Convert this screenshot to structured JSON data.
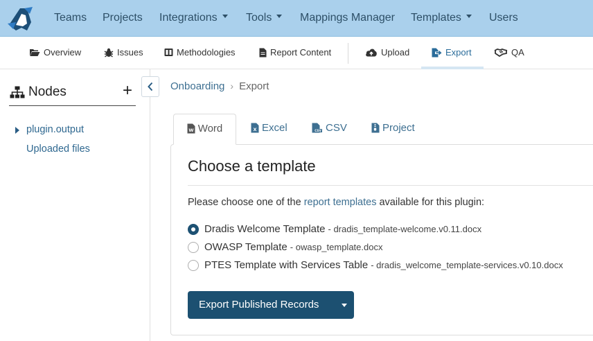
{
  "topnav": {
    "items": [
      {
        "label": "Teams"
      },
      {
        "label": "Projects"
      },
      {
        "label": "Integrations"
      },
      {
        "label": "Tools"
      },
      {
        "label": "Mappings Manager"
      },
      {
        "label": "Templates"
      },
      {
        "label": "Users"
      }
    ]
  },
  "subnav": {
    "items": [
      {
        "label": "Overview",
        "icon": "folder-open-icon"
      },
      {
        "label": "Issues",
        "icon": "bug-icon"
      },
      {
        "label": "Methodologies",
        "icon": "book-icon"
      },
      {
        "label": "Report Content",
        "icon": "file-icon"
      },
      {
        "label": "Upload",
        "icon": "cloud-upload-icon"
      },
      {
        "label": "Export",
        "icon": "export-icon"
      },
      {
        "label": "QA",
        "icon": "handshake-icon"
      }
    ],
    "active": "Export"
  },
  "sidebar": {
    "title": "Nodes",
    "add_label": "+",
    "nodes": [
      {
        "label": "plugin.output"
      },
      {
        "label": "Uploaded files"
      }
    ]
  },
  "breadcrumb": {
    "parent": "Onboarding",
    "current": "Export"
  },
  "tabs": [
    {
      "label": "Word",
      "icon": "file-word-icon"
    },
    {
      "label": "Excel",
      "icon": "file-excel-icon"
    },
    {
      "label": "CSV",
      "icon": "file-csv-icon"
    },
    {
      "label": "Project",
      "icon": "file-archive-icon"
    }
  ],
  "panel": {
    "heading": "Choose a template",
    "prompt_before": "Please choose one of the ",
    "prompt_link": "report templates",
    "prompt_after": " available for this plugin:",
    "templates": [
      {
        "name": "Dradis Welcome Template",
        "file": "- dradis_template-welcome.v0.11.docx",
        "selected": true
      },
      {
        "name": "OWASP Template",
        "file": "- owasp_template.docx",
        "selected": false
      },
      {
        "name": "PTES Template with Services Table",
        "file": "- dradis_welcome_template-services.v0.10.docx",
        "selected": false
      }
    ],
    "button_label": "Export Published Records"
  },
  "colors": {
    "topnav_bg": "#aad0ec",
    "accent": "#1c5071",
    "link": "#3d6f91"
  }
}
